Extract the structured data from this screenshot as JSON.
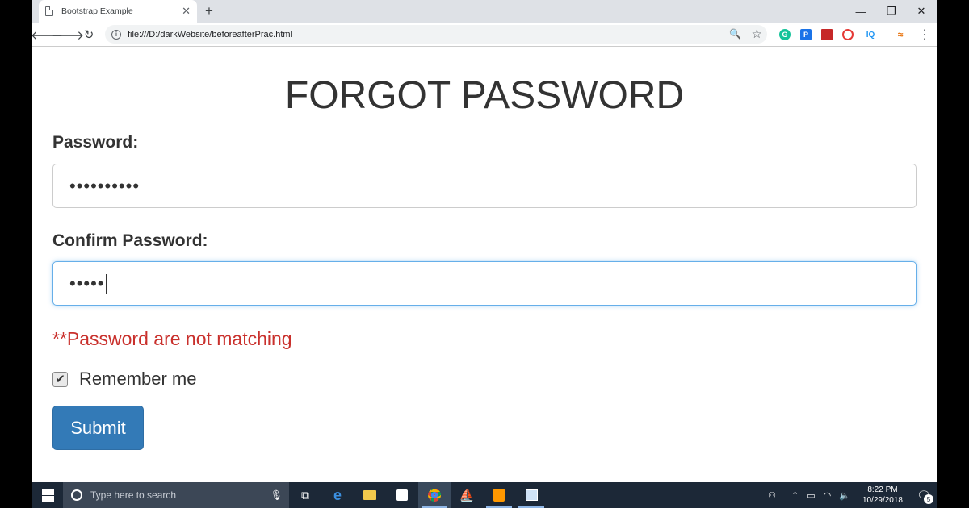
{
  "browser": {
    "tab_title": "Bootstrap Example",
    "url": "file:///D:/darkWebsite/beforeafterPrac.html",
    "new_tab_label": "+",
    "extensions": [
      {
        "name": "grammarly-icon",
        "label": "G",
        "color": "#15c39a"
      },
      {
        "name": "pushbullet-icon",
        "label": "P",
        "color": "#1a73e8"
      },
      {
        "name": "red-square-ext-icon",
        "label": "",
        "color": "#c62828"
      },
      {
        "name": "opera-icon",
        "label": "O",
        "color": "#e53935"
      },
      {
        "name": "iq-ext-icon",
        "label": "IQ",
        "color": "#2196f3"
      }
    ]
  },
  "page": {
    "title": "FORGOT PASSWORD",
    "password_label": "Password:",
    "password_value": "••••••••••",
    "confirm_label": "Confirm Password:",
    "confirm_value": "•••••",
    "error_message": "**Password are not matching",
    "remember_label": "Remember me",
    "remember_checked": true,
    "submit_label": "Submit"
  },
  "taskbar": {
    "search_placeholder": "Type here to search",
    "time": "8:22 PM",
    "date": "10/29/2018",
    "notification_count": "5"
  }
}
